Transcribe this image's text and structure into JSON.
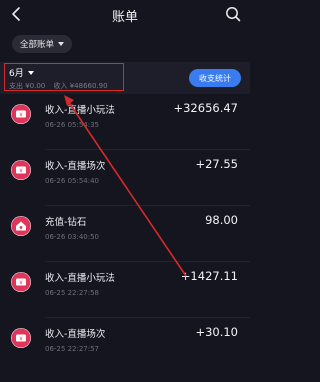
{
  "header": {
    "title": "账单",
    "back_icon": "chevron-left-icon",
    "search_icon": "search-icon"
  },
  "filter": {
    "label": "全部账单"
  },
  "summary": {
    "month": "6月",
    "expense": "支出 ¥0.00",
    "income": "收入 ¥48660.90",
    "stats_button": "收支统计"
  },
  "transactions": [
    {
      "name": "收入-直播小玩法",
      "time": "06-26 05:54:35",
      "amount": "+32656.47",
      "icon": "income-yen-icon"
    },
    {
      "name": "收入-直播场次",
      "time": "06-26 05:54:40",
      "amount": "+27.55",
      "icon": "income-yen-icon"
    },
    {
      "name": "充值-钻石",
      "time": "06-26 03:40:50",
      "amount": "98.00",
      "icon": "recharge-home-icon"
    },
    {
      "name": "收入-直播小玩法",
      "time": "06-25 22:27:58",
      "amount": "+1427.11",
      "icon": "income-yen-icon"
    },
    {
      "name": "收入-直播场次",
      "time": "06-25 22:27:57",
      "amount": "+30.10",
      "icon": "income-yen-icon"
    }
  ],
  "colors": {
    "background": "#15151f",
    "accent_blue": "#3a7bf0",
    "icon_red": "#e0355a",
    "annotation_red": "#d72a2a"
  }
}
